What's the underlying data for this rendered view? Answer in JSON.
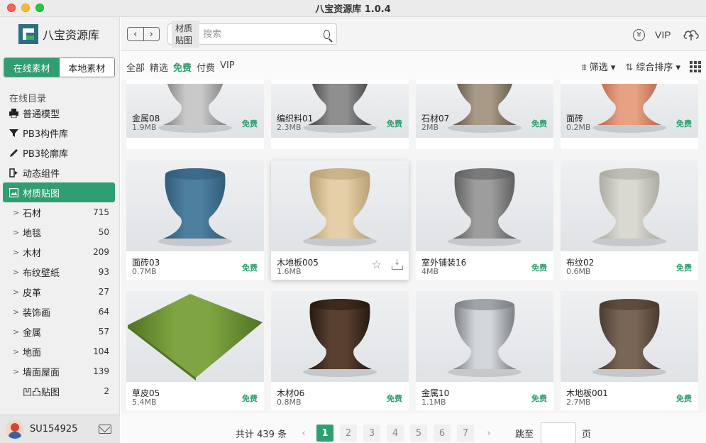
{
  "window": {
    "title": "八宝资源库 1.0.4"
  },
  "sidebar": {
    "app_name": "八宝资源库",
    "source_tabs": [
      {
        "label": "在线素材",
        "active": true
      },
      {
        "label": "本地素材",
        "active": false
      }
    ],
    "section_label": "在线目录",
    "nav": [
      {
        "label": "普通模型",
        "icon": "printer-icon"
      },
      {
        "label": "PB3构件库",
        "icon": "funnel-icon"
      },
      {
        "label": "PB3轮廓库",
        "icon": "pen-icon"
      },
      {
        "label": "动态组件",
        "icon": "component-icon"
      },
      {
        "label": "材质贴图",
        "icon": "image-icon",
        "active": true
      }
    ],
    "subcategories": [
      {
        "label": "石材",
        "count": "715"
      },
      {
        "label": "地毯",
        "count": "50"
      },
      {
        "label": "木材",
        "count": "209"
      },
      {
        "label": "布纹壁纸",
        "count": "93"
      },
      {
        "label": "皮革",
        "count": "27"
      },
      {
        "label": "装饰画",
        "count": "64"
      },
      {
        "label": "金属",
        "count": "57"
      },
      {
        "label": "地面",
        "count": "104"
      },
      {
        "label": "墙面屋面",
        "count": "139"
      },
      {
        "label": "凹凸贴图",
        "count": "2"
      }
    ],
    "user": {
      "name": "SU154925"
    }
  },
  "topbar": {
    "search_tag": "材质贴图",
    "search_placeholder": "搜索",
    "yen_symbol": "¥",
    "vip_label": "VIP"
  },
  "filters": {
    "tabs": [
      {
        "label": "全部"
      },
      {
        "label": "精选"
      },
      {
        "label": "免费",
        "active": true
      },
      {
        "label": "付费"
      },
      {
        "label": "VIP"
      }
    ],
    "filter_label": "筛选",
    "sort_label": "综合排序"
  },
  "materials": [
    {
      "name": "金属08",
      "size": "1.9MB",
      "badge": "免费",
      "color": "#c9c9c9",
      "shade": "#7d7d7d"
    },
    {
      "name": "编织料01",
      "size": "2.3MB",
      "badge": "免费",
      "color": "#8f8f8f",
      "shade": "#444444"
    },
    {
      "name": "石材07",
      "size": "2MB",
      "badge": "免费",
      "color": "#a99a87",
      "shade": "#5e5346"
    },
    {
      "name": "面砖",
      "size": "0.2MB",
      "badge": "免费",
      "color": "#e7a183",
      "shade": "#b6664a"
    },
    {
      "name": "面砖03",
      "size": "0.7MB",
      "badge": "免费",
      "color": "#4d7f9f",
      "shade": "#2f5a76"
    },
    {
      "name": "木地板005",
      "size": "1.6MB",
      "badge": "免费",
      "color": "#e4cfa8",
      "shade": "#b89d70",
      "hover": true
    },
    {
      "name": "室外铺装16",
      "size": "4MB",
      "badge": "免费",
      "color": "#9d9d9d",
      "shade": "#5c5c5c"
    },
    {
      "name": "布纹02",
      "size": "0.6MB",
      "badge": "免费",
      "color": "#d9d8d1",
      "shade": "#aaa89f"
    },
    {
      "name": "草皮05",
      "size": "5.4MB",
      "badge": "免费",
      "color": "#7fa542",
      "shade": "#4f7321",
      "flat": true
    },
    {
      "name": "木材06",
      "size": "0.8MB",
      "badge": "免费",
      "color": "#5a4030",
      "shade": "#24170f"
    },
    {
      "name": "金属10",
      "size": "1.1MB",
      "badge": "免费",
      "color": "#d3d6d9",
      "shade": "#767a7e"
    },
    {
      "name": "木地板001",
      "size": "2.7MB",
      "badge": "免费",
      "color": "#7a6656",
      "shade": "#47392e"
    }
  ],
  "pager": {
    "total": "共计 439 条",
    "prev": "‹",
    "next": "›",
    "pages": [
      "1",
      "2",
      "3",
      "4",
      "5",
      "6",
      "7"
    ],
    "current": "1",
    "jump_label": "跳至",
    "page_unit": "页"
  },
  "colors": {
    "accent": "#2f9e70"
  }
}
